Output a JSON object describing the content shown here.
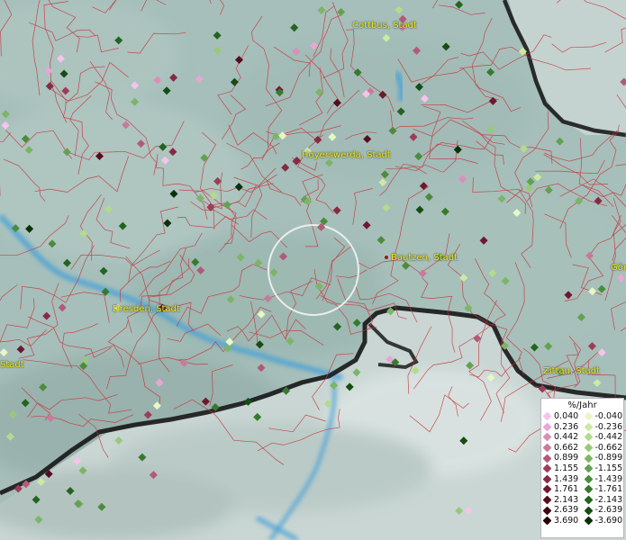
{
  "map": {
    "cities": [
      {
        "name": "Cottbus, Stadt"
      },
      {
        "name": "Hoyerswerda, Stadt"
      },
      {
        "name": "Bautzen, Stadt"
      },
      {
        "name": "Dresden, Stadt"
      },
      {
        "name": "Zittau, Stadt"
      },
      {
        "name": "Stadt"
      },
      {
        "name": "Gör"
      }
    ]
  },
  "legend": {
    "title": "%/Jahr",
    "positive": [
      "0.040",
      "0.236",
      "0.442",
      "0.662",
      "0.899",
      "1.155",
      "1.439",
      "1.761",
      "2.143",
      "2.639",
      "3.690"
    ],
    "negative": [
      "-0.040",
      "-0.236",
      "-0.442",
      "-0.662",
      "-0.899",
      "-1.155",
      "-1.439",
      "-1.761",
      "-2.143",
      "-2.639",
      "-3.690"
    ],
    "positive_colors": [
      "#f6c3ec",
      "#e8a6d4",
      "#d98fb8",
      "#c97a9b",
      "#b25a78",
      "#9c3d5a",
      "#862b44",
      "#6d1930",
      "#560d1f",
      "#3e0712",
      "#270308"
    ],
    "negative_colors": [
      "#e8f7c4",
      "#cbeaa3",
      "#b3db8c",
      "#98c97a",
      "#7cb566",
      "#62a151",
      "#4b8c3d",
      "#377a2e",
      "#236420",
      "#154d14",
      "#0a300a"
    ]
  }
}
